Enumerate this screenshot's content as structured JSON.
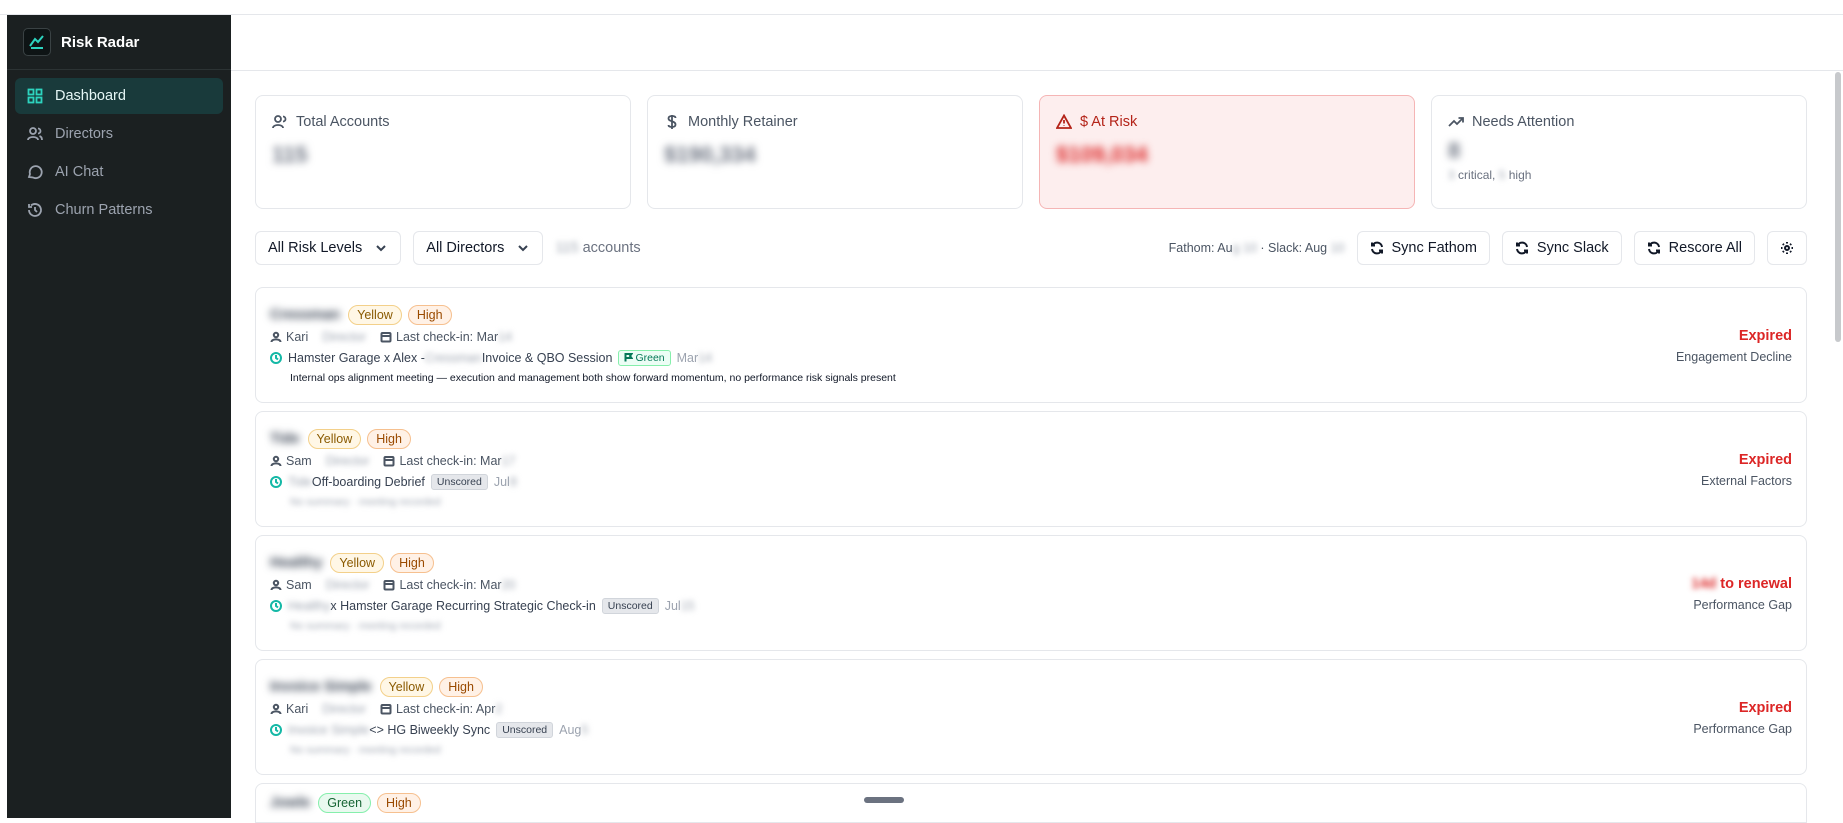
{
  "app": {
    "title": "Risk Radar"
  },
  "sidebar": {
    "items": [
      {
        "label": "Dashboard",
        "icon": "dashboard-icon",
        "active": true
      },
      {
        "label": "Directors",
        "icon": "users-icon"
      },
      {
        "label": "AI Chat",
        "icon": "chat-icon"
      },
      {
        "label": "Churn Patterns",
        "icon": "history-icon"
      }
    ]
  },
  "stats": {
    "total_accounts": {
      "label": "Total Accounts",
      "value": "115"
    },
    "monthly_retainer": {
      "label": "Monthly Retainer",
      "value": "$190,334"
    },
    "at_risk": {
      "label": "$ At Risk",
      "value": "$109,034"
    },
    "needs_attention": {
      "label": "Needs Attention",
      "value": "8",
      "critical_count": "3",
      "critical_label": "critical,",
      "high_count": "5",
      "high_label": "high"
    }
  },
  "toolbar": {
    "risk_filter": "All Risk Levels",
    "director_filter": "All Directors",
    "account_count": "115",
    "accounts_label": "accounts",
    "fathom_label": "Fathom: Au",
    "fathom_blur": "g 10",
    "slack_label": "· Slack: Aug",
    "slack_blur": " 10",
    "sync_fathom": "Sync Fathom",
    "sync_slack": "Sync Slack",
    "rescore_all": "Rescore All"
  },
  "accounts": [
    {
      "name": "Cressman",
      "risk": "Yellow",
      "priority": "High",
      "director": "Kari",
      "director_blur": "Director",
      "checkin_label": "Last check-in: Mar",
      "checkin_blur": " 14",
      "meeting_prefix": "Hamster Garage x Alex - ",
      "meeting_blur": "Cressman",
      "meeting_suffix": " Invoice & QBO Session",
      "meeting_tag": "Green",
      "meeting_date": "Mar",
      "meeting_date_blur": " 14",
      "summary": "Internal ops alignment meeting — execution and management both show forward momentum, no performance risk signals present",
      "status": "Expired",
      "reason": "Engagement Decline"
    },
    {
      "name": "Tide",
      "risk": "Yellow",
      "priority": "High",
      "director": "Sam",
      "director_blur": "Director",
      "checkin_label": "Last check-in: Mar",
      "checkin_blur": " 17",
      "meeting_prefix_blur": "Tide",
      "meeting_name": "Off-boarding Debrief",
      "meeting_tag": "Unscored",
      "meeting_date": "Jul",
      "meeting_date_blur": " 8",
      "summary_blur": "No summary · meeting recorded",
      "status": "Expired",
      "reason": "External Factors"
    },
    {
      "name": "Healthy",
      "risk": "Yellow",
      "priority": "High",
      "director": "Sam",
      "director_blur": "Director",
      "checkin_label": "Last check-in: Mar",
      "checkin_blur": " 20",
      "meeting_prefix_blur": "Healthy",
      "meeting_name": " x Hamster Garage Recurring Strategic Check-in",
      "meeting_tag": "Unscored",
      "meeting_date": "Jul",
      "meeting_date_blur": " 15",
      "summary_blur": "No summary · meeting recorded",
      "status_blur": "14d",
      "status": " to renewal",
      "reason": "Performance Gap"
    },
    {
      "name": "Invoice Simple",
      "risk": "Yellow",
      "priority": "High",
      "director": "Kari",
      "director_blur": "Director",
      "checkin_label": "Last check-in: Apr",
      "checkin_blur": " 2",
      "meeting_prefix_blur": "Invoice Simple",
      "meeting_name": " <> HG Biweekly Sync",
      "meeting_tag": "Unscored",
      "meeting_date": "Aug",
      "meeting_date_blur": " 5",
      "summary_blur": "No summary · meeting recorded",
      "status": "Expired",
      "reason": "Performance Gap"
    },
    {
      "name": "Jowle",
      "risk": "Green",
      "priority": "High"
    }
  ]
}
